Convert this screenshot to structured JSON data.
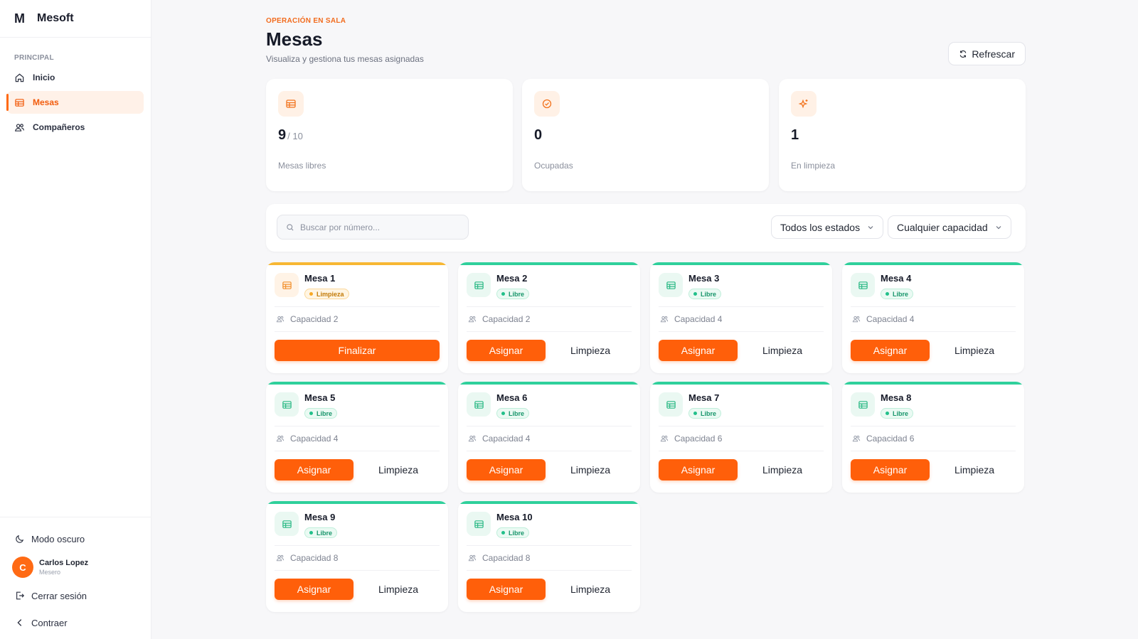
{
  "brand": {
    "logo": "M",
    "name": "Mesoft"
  },
  "sidebar": {
    "section": "PRINCIPAL",
    "items": [
      {
        "label": "Inicio",
        "icon": "home-icon"
      },
      {
        "label": "Mesas",
        "icon": "table-icon",
        "active": true
      },
      {
        "label": "Compañeros",
        "icon": "users-icon"
      }
    ],
    "dark_mode": "Modo oscuro",
    "user": {
      "initial": "C",
      "name": "Carlos Lopez",
      "role": "Mesero"
    },
    "logout": "Cerrar sesión",
    "collapse": "Contraer"
  },
  "header": {
    "eyebrow": "OPERACIÓN EN SALA",
    "title": "Mesas",
    "subtitle": "Visualiza y gestiona tus mesas asignadas",
    "refresh": "Refrescar"
  },
  "stats": [
    {
      "value": "9",
      "total": "/ 10",
      "label": "Mesas libres",
      "icon": "table-icon"
    },
    {
      "value": "0",
      "total": "",
      "label": "Ocupadas",
      "icon": "check-circle-icon"
    },
    {
      "value": "1",
      "total": "",
      "label": "En limpieza",
      "icon": "sparkle-icon"
    }
  ],
  "filters": {
    "search_placeholder": "Buscar por número...",
    "status": "Todos los estados",
    "capacity": "Cualquier capacidad"
  },
  "tables": [
    {
      "name": "Mesa 1",
      "status": "Limpieza",
      "capacity": "Capacidad 2",
      "primary": "Finalizar",
      "secondary": ""
    },
    {
      "name": "Mesa 2",
      "status": "Libre",
      "capacity": "Capacidad 2",
      "primary": "Asignar",
      "secondary": "Limpieza"
    },
    {
      "name": "Mesa 3",
      "status": "Libre",
      "capacity": "Capacidad 4",
      "primary": "Asignar",
      "secondary": "Limpieza"
    },
    {
      "name": "Mesa 4",
      "status": "Libre",
      "capacity": "Capacidad 4",
      "primary": "Asignar",
      "secondary": "Limpieza"
    },
    {
      "name": "Mesa 5",
      "status": "Libre",
      "capacity": "Capacidad 4",
      "primary": "Asignar",
      "secondary": "Limpieza"
    },
    {
      "name": "Mesa 6",
      "status": "Libre",
      "capacity": "Capacidad 4",
      "primary": "Asignar",
      "secondary": "Limpieza"
    },
    {
      "name": "Mesa 7",
      "status": "Libre",
      "capacity": "Capacidad 6",
      "primary": "Asignar",
      "secondary": "Limpieza"
    },
    {
      "name": "Mesa 8",
      "status": "Libre",
      "capacity": "Capacidad 6",
      "primary": "Asignar",
      "secondary": "Limpieza"
    },
    {
      "name": "Mesa 9",
      "status": "Libre",
      "capacity": "Capacidad 8",
      "primary": "Asignar",
      "secondary": "Limpieza"
    },
    {
      "name": "Mesa 10",
      "status": "Libre",
      "capacity": "Capacidad 8",
      "primary": "Asignar",
      "secondary": "Limpieza"
    }
  ],
  "colors": {
    "accent": "#ff5f0a",
    "libre": "#2fd09b",
    "limpieza": "#f7b733"
  }
}
